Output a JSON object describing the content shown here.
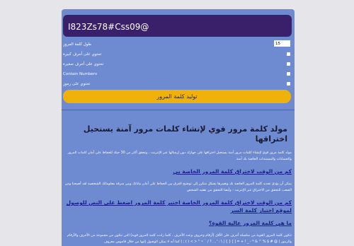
{
  "password": "I823Zs78#Css09@",
  "options": [
    {
      "label": "طول كلمة المرور",
      "kind": "number",
      "value": "15"
    },
    {
      "label": "تحتوي على أحرف كبيرة",
      "kind": "checkbox"
    },
    {
      "label": "تحتوي على أحرف صغيرة",
      "kind": "checkbox"
    },
    {
      "label": "Contain Numbers",
      "kind": "checkbox"
    },
    {
      "label": "تحتوي على رموز",
      "kind": "checkbox"
    }
  ],
  "generate_label": "توليد كلمة المرور",
  "article": {
    "title": "مولد كلمة مرور قوي لإنشاء كلمات مرور آمنة يستحيل اختراقها",
    "intro": "مولد كلمة مرور قوي لإنشاء كلمات مرور آمنة يستحيل اختراقها على جهازك دون إرسالها عبر الإنترنت ، وتحقق أكثر من 30 حيلة للحفاظ على أمان كلمات المرور والحسابات والمستندات الخاصة بك آمنة",
    "link1": "كم من الوقت لاختراق كلمة المرور الخاصة بي",
    "para2": "يمكن أن يؤدي تحديد كلمة المرور الخاصة بك وتغييرها بشكل متكرر إلى توضيح الفرق بين الحفاظ على أمان بياناتك وبين سرقة معلوماتك الشخصية لقد أصبحنا ومن الصعب للتحقق من الاختراق عبر الإنترنت - وأيضا التحقق من تعقيد الشخص",
    "link2": "كم من الوقت لاختراق كلمة المرور الخاصة اختبر كلمة المرور اضغط على النص للوصول لموقع اختبار كلمة السر",
    "link3": "ما هي كلمة المرور عالية القوة؟",
    "para3": "تتكون كلمة المرور القوية من سلسلة أحرف على الأقل (أرقام وحروف وعدد الأحرف ، كلما زادت كلمة المرور قوية) التي تتكون من مجموعة من الأحرف والأرقام والرموز ( @ # $ % ^ & * - _ ! + = [ ] { } | \\ : ' , . ? / ` ~ \" < > ( ) ; ) كما أنه لا يمكن الوصول إليها من خلال قاموس معروف"
  }
}
